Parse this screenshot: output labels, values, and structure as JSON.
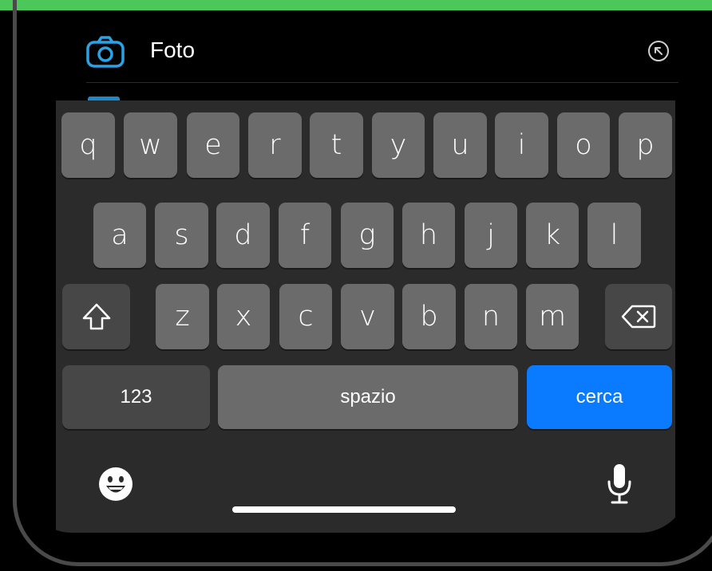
{
  "results": {
    "first_row": {
      "label": "Foto",
      "icon": "camera-icon",
      "action_icon": "arrow-up-left-icon"
    }
  },
  "keyboard": {
    "row1": [
      "q",
      "w",
      "e",
      "r",
      "t",
      "y",
      "u",
      "i",
      "o",
      "p"
    ],
    "row2": [
      "a",
      "s",
      "d",
      "f",
      "g",
      "h",
      "j",
      "k",
      "l"
    ],
    "row3": [
      "z",
      "x",
      "c",
      "v",
      "b",
      "n",
      "m"
    ],
    "shift_icon": "shift-icon",
    "delete_icon": "delete-icon",
    "numbers_label": "123",
    "space_label": "spazio",
    "search_label": "cerca",
    "emoji_icon": "emoji-icon",
    "mic_icon": "microphone-icon"
  },
  "colors": {
    "status_bar": "#4cc75a",
    "accent_blue": "#0a7aff",
    "camera_icon": "#2aa3e6"
  }
}
